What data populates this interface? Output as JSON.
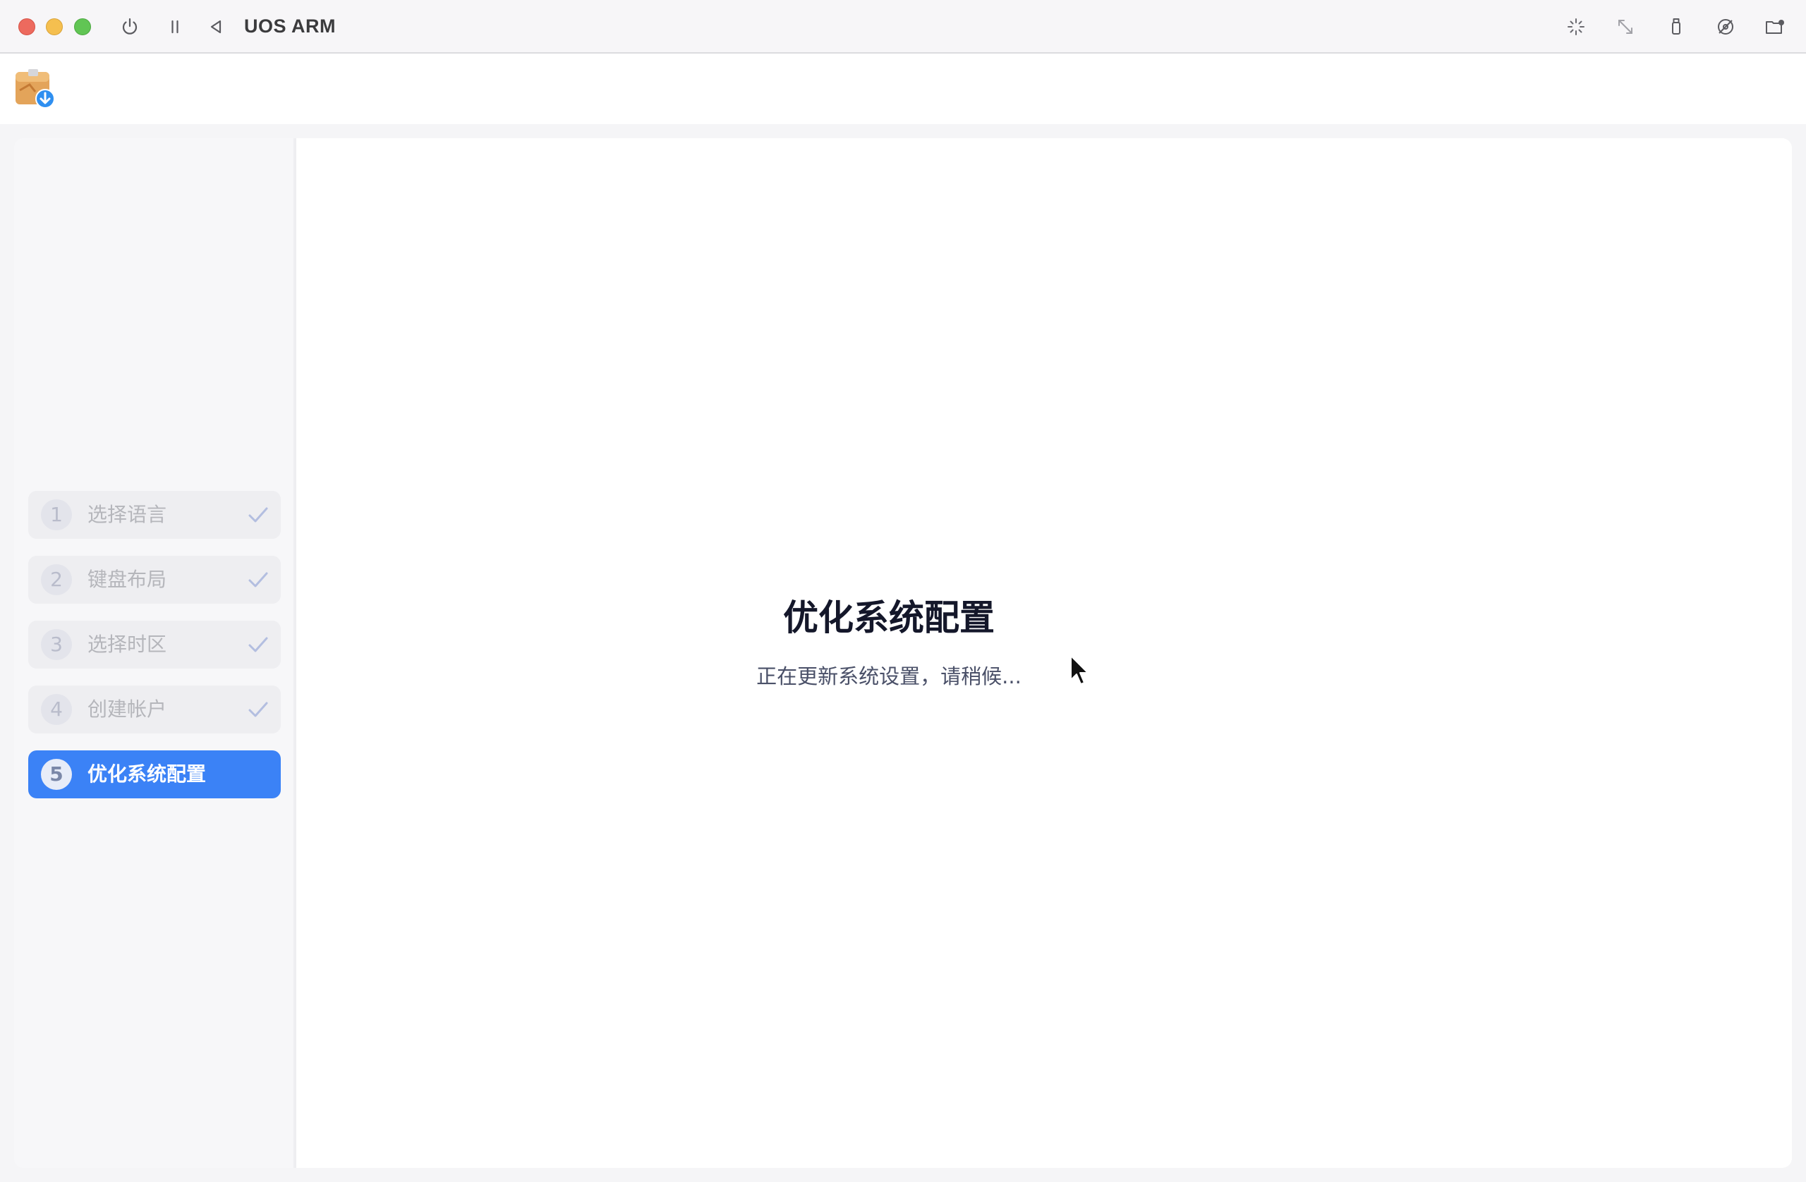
{
  "vm": {
    "title": "UOS ARM",
    "controls": [
      "power-icon",
      "pause-icon",
      "back-icon"
    ],
    "toolbar_icons": [
      "snapshot-icon",
      "resize-icon",
      "usb-icon",
      "disc-icon",
      "shared-folder-icon"
    ]
  },
  "app": {
    "logo": "installer-package-icon"
  },
  "steps": [
    {
      "num": "1",
      "label": "选择语言",
      "done": true
    },
    {
      "num": "2",
      "label": "键盘布局",
      "done": true
    },
    {
      "num": "3",
      "label": "选择时区",
      "done": true
    },
    {
      "num": "4",
      "label": "创建帐户",
      "done": true
    },
    {
      "num": "5",
      "label": "优化系统配置",
      "active": true
    }
  ],
  "main": {
    "title": "优化系统配置",
    "subtitle": "正在更新系统设置，请稍候..."
  },
  "colors": {
    "accent": "#3b82f6",
    "step_inactive_bg": "#eeeef1",
    "title_text": "#14172a"
  }
}
